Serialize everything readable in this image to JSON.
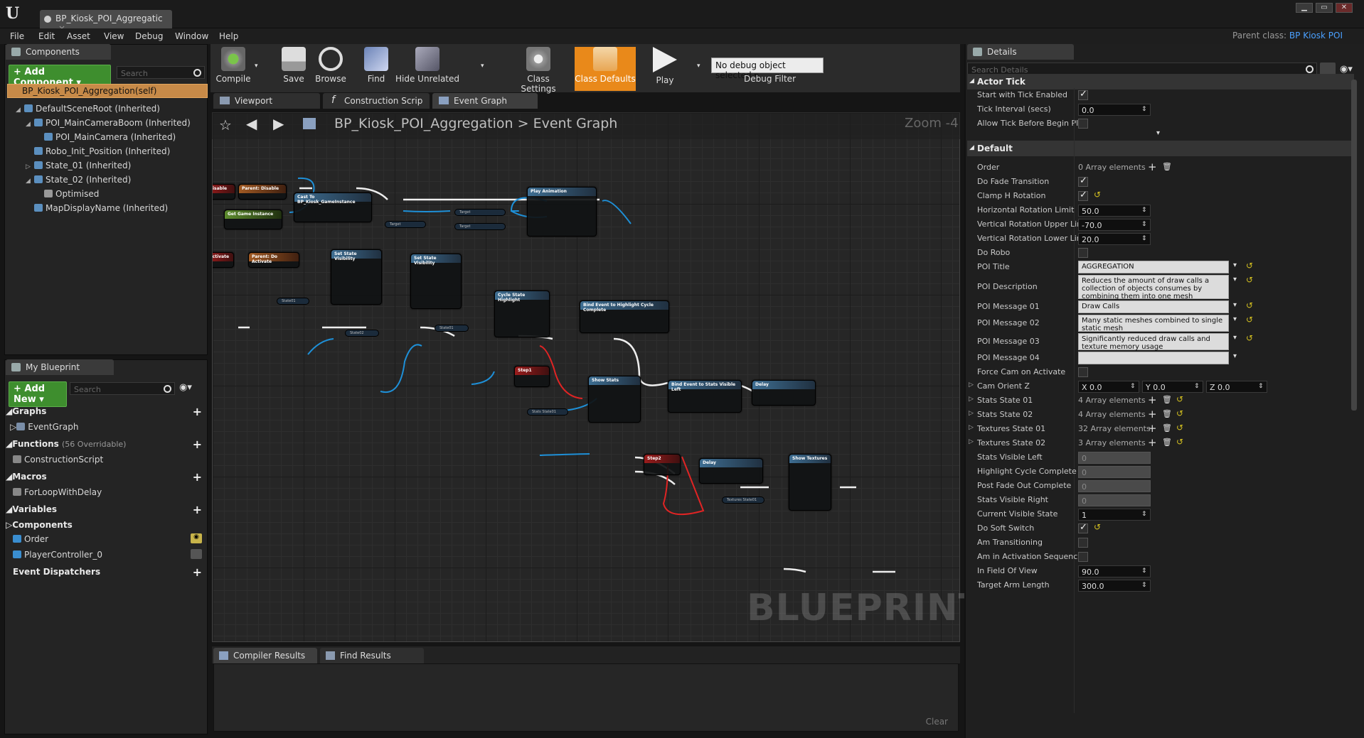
{
  "window": {
    "tab_title": "BP_Kiosk_POI_Aggregatic",
    "tab_close": "×",
    "parent_class_label": "Parent class:",
    "parent_class_value": "BP Kiosk POI",
    "logo": "U"
  },
  "menu": [
    "File",
    "Edit",
    "Asset",
    "View",
    "Debug",
    "Window",
    "Help"
  ],
  "components_panel": {
    "tab": "Components",
    "add_button": "+ Add Component ▾",
    "search_placeholder": "Search",
    "selected": "BP_Kiosk_POI_Aggregation(self)",
    "tree": [
      {
        "label": "DefaultSceneRoot (Inherited)",
        "indent": 0,
        "arrow": "◢"
      },
      {
        "label": "POI_MainCameraBoom (Inherited)",
        "indent": 1,
        "arrow": "◢"
      },
      {
        "label": "POI_MainCamera (Inherited)",
        "indent": 2,
        "arrow": ""
      },
      {
        "label": "Robo_Init_Position (Inherited)",
        "indent": 1,
        "arrow": ""
      },
      {
        "label": "State_01 (Inherited)",
        "indent": 1,
        "arrow": "▷"
      },
      {
        "label": "State_02 (Inherited)",
        "indent": 1,
        "arrow": "◢"
      },
      {
        "label": "Optimised",
        "indent": 2,
        "arrow": ""
      },
      {
        "label": "MapDisplayName (Inherited)",
        "indent": 1,
        "arrow": ""
      }
    ]
  },
  "my_blueprint": {
    "tab": "My Blueprint",
    "add_button": "+ Add New ▾",
    "search_placeholder": "Search",
    "graphs_label": "Graphs",
    "event_graph": "EventGraph",
    "functions_label": "Functions",
    "functions_count": "(56 Overridable)",
    "construction_script": "ConstructionScript",
    "macros_label": "Macros",
    "macro_item": "ForLoopWithDelay",
    "variables_label": "Variables",
    "components_label": "Components",
    "comp_items": [
      "Order",
      "PlayerController_0"
    ],
    "dispatchers_label": "Event Dispatchers"
  },
  "toolbar": {
    "buttons": [
      "Compile",
      "Save",
      "Browse",
      "Find",
      "Hide Unrelated",
      "Class Settings",
      "Class Defaults",
      "Play"
    ],
    "debug_select": "No debug object selected ▾",
    "debug_filter": "Debug Filter"
  },
  "graph_tabs": [
    "Viewport",
    "Construction Scrip",
    "Event Graph"
  ],
  "graph": {
    "breadcrumb_bp": "BP_Kiosk_POI_Aggregation",
    "breadcrumb_sep": ">",
    "breadcrumb_graph": "Event Graph",
    "zoom": "Zoom -4",
    "watermark": "BLUEPRINT",
    "nodes": {
      "disable": "Disable",
      "parent_disable": "Parent: Disable",
      "cast": "Cast To BP_Kiosk_GameInstance",
      "get_game_instance": "Get Game Instance",
      "play_animation": "Play Animation",
      "activate": "Activate",
      "parent_activate": "Parent: Do Activate",
      "set_state_vis_1": "Set State Visibility",
      "set_state_vis_2": "Set State Visibility",
      "cycle_state": "Cycle State Highlight",
      "bind_highlight": "Bind Event to Highlight Cycle Complete",
      "step1": "Step1",
      "show_stats": "Show Stats",
      "bind_stats": "Bind Event to Stats Visible Left",
      "delay1": "Delay",
      "step2": "Step2",
      "delay2": "Delay",
      "show_textures": "Show Textures",
      "state01": "State01",
      "state02": "State02",
      "state01b": "State01",
      "stats_state01": "Stats State01",
      "textures_state01": "Textures State01"
    }
  },
  "bottom": {
    "tabs": [
      "Compiler Results",
      "Find Results"
    ],
    "clear": "Clear"
  },
  "details": {
    "tab": "Details",
    "search_placeholder": "Search Details",
    "actor_tick": "Actor Tick",
    "tick_rows": [
      {
        "label": "Start with Tick Enabled",
        "type": "check",
        "on": true
      },
      {
        "label": "Tick Interval (secs)",
        "type": "num",
        "value": "0.0"
      },
      {
        "label": "Allow Tick Before Begin Play",
        "type": "check",
        "on": false
      }
    ],
    "default": "Default",
    "rows": [
      {
        "label": "Order",
        "type": "array",
        "value": "0 Array elements"
      },
      {
        "label": "Do Fade Transition",
        "type": "check",
        "on": true
      },
      {
        "label": "Clamp H Rotation",
        "type": "check",
        "on": true,
        "reset": true
      },
      {
        "label": "Horizontal Rotation Limit",
        "type": "num",
        "value": "50.0"
      },
      {
        "label": "Vertical Rotation Upper Limit",
        "type": "num",
        "value": "-70.0"
      },
      {
        "label": "Vertical Rotation Lower Limit",
        "type": "num",
        "value": "20.0"
      },
      {
        "label": "Do Robo",
        "type": "check",
        "on": false
      },
      {
        "label": "POI Title",
        "type": "text",
        "value": "AGGREGATION"
      },
      {
        "label": "POI Description",
        "type": "text",
        "value": "Reduces the amount of draw calls a collection of objects consumes by combining them into one mesh"
      },
      {
        "label": "POI Message 01",
        "type": "text",
        "value": "Draw Calls"
      },
      {
        "label": "POI Message 02",
        "type": "text",
        "value": "Many static meshes combined to single static mesh"
      },
      {
        "label": "POI Message 03",
        "type": "text",
        "value": "Significantly reduced draw calls and texture memory usage"
      },
      {
        "label": "POI Message 04",
        "type": "text",
        "value": ""
      },
      {
        "label": "Force Cam on Activate",
        "type": "check",
        "on": false
      },
      {
        "label": "Cam Orient Z",
        "type": "vec",
        "x": "0.0",
        "y": "0.0",
        "z": "0.0"
      },
      {
        "label": "Stats State 01",
        "type": "array",
        "value": "4 Array elements"
      },
      {
        "label": "Stats State 02",
        "type": "array",
        "value": "4 Array elements"
      },
      {
        "label": "Textures State 01",
        "type": "array",
        "value": "32 Array elements"
      },
      {
        "label": "Textures State 02",
        "type": "array",
        "value": "3 Array elements"
      },
      {
        "label": "Stats Visible Left",
        "type": "grey",
        "value": "0"
      },
      {
        "label": "Highlight Cycle Complete",
        "type": "grey",
        "value": "0"
      },
      {
        "label": "Post Fade Out Complete",
        "type": "grey",
        "value": "0"
      },
      {
        "label": "Stats Visible Right",
        "type": "grey",
        "value": "0"
      },
      {
        "label": "Current Visible State",
        "type": "num",
        "value": "1"
      },
      {
        "label": "Do Soft Switch",
        "type": "check",
        "on": true,
        "reset": true
      },
      {
        "label": "Am Transitioning",
        "type": "check",
        "on": false
      },
      {
        "label": "Am in Activation Sequence",
        "type": "check",
        "on": false
      },
      {
        "label": "In Field Of View",
        "type": "num",
        "value": "90.0"
      },
      {
        "label": "Target Arm Length",
        "type": "num",
        "value": "300.0"
      }
    ]
  },
  "colors": {
    "accent_orange": "#e9891a",
    "selection": "#c78a48",
    "add_green": "#3e8e2e",
    "link_blue": "#4aa0ff"
  }
}
